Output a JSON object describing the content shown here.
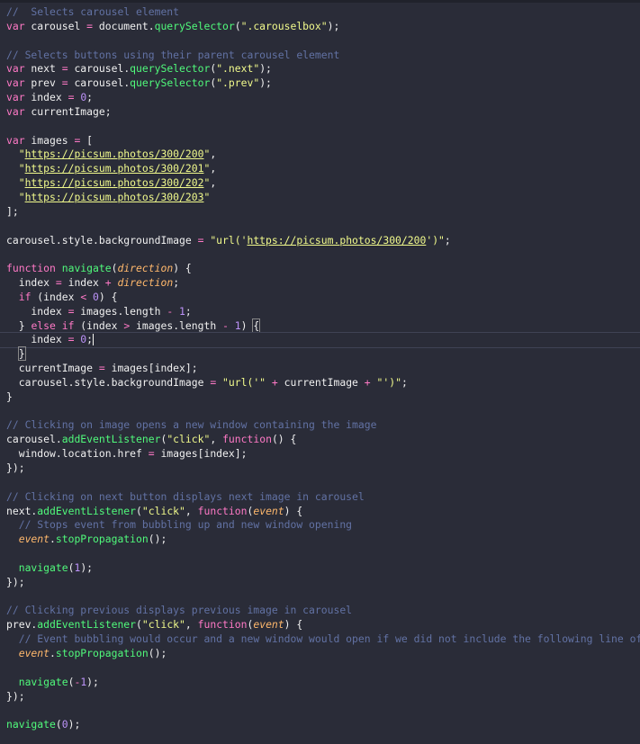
{
  "editor": {
    "language": "javascript",
    "theme_colors": {
      "background": "#2a2c38",
      "comment": "#6272a4",
      "keyword": "#ff79c6",
      "function": "#50fa7b",
      "string": "#f1fa8c",
      "number": "#bd93f9",
      "parameter": "#ffb86c"
    },
    "lines": [
      [
        {
          "t": "comment",
          "v": "//  Selects carousel element"
        }
      ],
      [
        {
          "t": "kw",
          "v": "var"
        },
        {
          "t": "var",
          "v": " carousel "
        },
        {
          "t": "op",
          "v": "="
        },
        {
          "t": "var",
          "v": " document."
        },
        {
          "t": "fn",
          "v": "querySelector"
        },
        {
          "t": "punc",
          "v": "("
        },
        {
          "t": "str",
          "v": "\".carouselbox\""
        },
        {
          "t": "punc",
          "v": ");"
        }
      ],
      [],
      [
        {
          "t": "comment",
          "v": "// Selects buttons using their parent carousel element"
        }
      ],
      [
        {
          "t": "kw",
          "v": "var"
        },
        {
          "t": "var",
          "v": " next "
        },
        {
          "t": "op",
          "v": "="
        },
        {
          "t": "var",
          "v": " carousel."
        },
        {
          "t": "fn",
          "v": "querySelector"
        },
        {
          "t": "punc",
          "v": "("
        },
        {
          "t": "str",
          "v": "\".next\""
        },
        {
          "t": "punc",
          "v": ");"
        }
      ],
      [
        {
          "t": "kw",
          "v": "var"
        },
        {
          "t": "var",
          "v": " prev "
        },
        {
          "t": "op",
          "v": "="
        },
        {
          "t": "var",
          "v": " carousel."
        },
        {
          "t": "fn",
          "v": "querySelector"
        },
        {
          "t": "punc",
          "v": "("
        },
        {
          "t": "str",
          "v": "\".prev\""
        },
        {
          "t": "punc",
          "v": ");"
        }
      ],
      [
        {
          "t": "kw",
          "v": "var"
        },
        {
          "t": "var",
          "v": " index "
        },
        {
          "t": "op",
          "v": "="
        },
        {
          "t": "var",
          "v": " "
        },
        {
          "t": "num",
          "v": "0"
        },
        {
          "t": "punc",
          "v": ";"
        }
      ],
      [
        {
          "t": "kw",
          "v": "var"
        },
        {
          "t": "var",
          "v": " currentImage;"
        }
      ],
      [],
      [
        {
          "t": "kw",
          "v": "var"
        },
        {
          "t": "var",
          "v": " images "
        },
        {
          "t": "op",
          "v": "="
        },
        {
          "t": "var",
          "v": " ["
        }
      ],
      [
        {
          "t": "var",
          "v": "  "
        },
        {
          "t": "str",
          "v": "\""
        },
        {
          "t": "link",
          "v": "https://picsum.photos/300/200"
        },
        {
          "t": "str",
          "v": "\""
        },
        {
          "t": "punc",
          "v": ","
        }
      ],
      [
        {
          "t": "var",
          "v": "  "
        },
        {
          "t": "str",
          "v": "\""
        },
        {
          "t": "link",
          "v": "https://picsum.photos/300/201"
        },
        {
          "t": "str",
          "v": "\""
        },
        {
          "t": "punc",
          "v": ","
        }
      ],
      [
        {
          "t": "var",
          "v": "  "
        },
        {
          "t": "str",
          "v": "\""
        },
        {
          "t": "link",
          "v": "https://picsum.photos/300/202"
        },
        {
          "t": "str",
          "v": "\""
        },
        {
          "t": "punc",
          "v": ","
        }
      ],
      [
        {
          "t": "var",
          "v": "  "
        },
        {
          "t": "str",
          "v": "\""
        },
        {
          "t": "link",
          "v": "https://picsum.photos/300/203"
        },
        {
          "t": "str",
          "v": "\""
        }
      ],
      [
        {
          "t": "punc",
          "v": "];"
        }
      ],
      [],
      [
        {
          "t": "var",
          "v": "carousel.style.backgroundImage "
        },
        {
          "t": "op",
          "v": "="
        },
        {
          "t": "var",
          "v": " "
        },
        {
          "t": "str",
          "v": "\"url('"
        },
        {
          "t": "link",
          "v": "https://picsum.photos/300/200"
        },
        {
          "t": "str",
          "v": "')\""
        },
        {
          "t": "punc",
          "v": ";"
        }
      ],
      [],
      [
        {
          "t": "kw",
          "v": "function"
        },
        {
          "t": "var",
          "v": " "
        },
        {
          "t": "fn",
          "v": "navigate"
        },
        {
          "t": "punc",
          "v": "("
        },
        {
          "t": "param",
          "v": "direction"
        },
        {
          "t": "punc",
          "v": ") {"
        }
      ],
      [
        {
          "t": "var",
          "v": "  index "
        },
        {
          "t": "op",
          "v": "="
        },
        {
          "t": "var",
          "v": " index "
        },
        {
          "t": "op",
          "v": "+"
        },
        {
          "t": "var",
          "v": " "
        },
        {
          "t": "param",
          "v": "direction"
        },
        {
          "t": "punc",
          "v": ";"
        }
      ],
      [
        {
          "t": "var",
          "v": "  "
        },
        {
          "t": "kw",
          "v": "if"
        },
        {
          "t": "var",
          "v": " (index "
        },
        {
          "t": "op",
          "v": "<"
        },
        {
          "t": "var",
          "v": " "
        },
        {
          "t": "num",
          "v": "0"
        },
        {
          "t": "var",
          "v": ") {"
        }
      ],
      [
        {
          "t": "var",
          "v": "    index "
        },
        {
          "t": "op",
          "v": "="
        },
        {
          "t": "var",
          "v": " images.length "
        },
        {
          "t": "op",
          "v": "-"
        },
        {
          "t": "var",
          "v": " "
        },
        {
          "t": "num",
          "v": "1"
        },
        {
          "t": "punc",
          "v": ";"
        }
      ],
      [
        {
          "t": "var",
          "v": "  } "
        },
        {
          "t": "kw",
          "v": "else if"
        },
        {
          "t": "var",
          "v": " (index "
        },
        {
          "t": "op",
          "v": ">"
        },
        {
          "t": "var",
          "v": " images.length "
        },
        {
          "t": "op",
          "v": "-"
        },
        {
          "t": "var",
          "v": " "
        },
        {
          "t": "num",
          "v": "1"
        },
        {
          "t": "var",
          "v": ") "
        },
        {
          "t": "bracket",
          "v": "{"
        }
      ],
      [
        {
          "t": "var",
          "v": "    index "
        },
        {
          "t": "op",
          "v": "="
        },
        {
          "t": "var",
          "v": " "
        },
        {
          "t": "num",
          "v": "0"
        },
        {
          "t": "punc",
          "v": ";"
        },
        {
          "t": "cursor",
          "v": ""
        }
      ],
      [
        {
          "t": "var",
          "v": "  "
        },
        {
          "t": "bracket",
          "v": "}"
        }
      ],
      [
        {
          "t": "var",
          "v": "  currentImage "
        },
        {
          "t": "op",
          "v": "="
        },
        {
          "t": "var",
          "v": " images[index];"
        }
      ],
      [
        {
          "t": "var",
          "v": "  carousel.style.backgroundImage "
        },
        {
          "t": "op",
          "v": "="
        },
        {
          "t": "var",
          "v": " "
        },
        {
          "t": "str",
          "v": "\"url('\""
        },
        {
          "t": "var",
          "v": " "
        },
        {
          "t": "op",
          "v": "+"
        },
        {
          "t": "var",
          "v": " currentImage "
        },
        {
          "t": "op",
          "v": "+"
        },
        {
          "t": "var",
          "v": " "
        },
        {
          "t": "str",
          "v": "\"')\""
        },
        {
          "t": "punc",
          "v": ";"
        }
      ],
      [
        {
          "t": "punc",
          "v": "}"
        }
      ],
      [],
      [
        {
          "t": "comment",
          "v": "// Clicking on image opens a new window containing the image"
        }
      ],
      [
        {
          "t": "var",
          "v": "carousel."
        },
        {
          "t": "fn",
          "v": "addEventListener"
        },
        {
          "t": "punc",
          "v": "("
        },
        {
          "t": "str",
          "v": "\"click\""
        },
        {
          "t": "punc",
          "v": ", "
        },
        {
          "t": "kw",
          "v": "function"
        },
        {
          "t": "punc",
          "v": "() {"
        }
      ],
      [
        {
          "t": "var",
          "v": "  window.location.href "
        },
        {
          "t": "op",
          "v": "="
        },
        {
          "t": "var",
          "v": " images[index];"
        }
      ],
      [
        {
          "t": "punc",
          "v": "});"
        }
      ],
      [],
      [
        {
          "t": "comment",
          "v": "// Clicking on next button displays next image in carousel"
        }
      ],
      [
        {
          "t": "var",
          "v": "next."
        },
        {
          "t": "fn",
          "v": "addEventListener"
        },
        {
          "t": "punc",
          "v": "("
        },
        {
          "t": "str",
          "v": "\"click\""
        },
        {
          "t": "punc",
          "v": ", "
        },
        {
          "t": "kw",
          "v": "function"
        },
        {
          "t": "punc",
          "v": "("
        },
        {
          "t": "param",
          "v": "event"
        },
        {
          "t": "punc",
          "v": ") {"
        }
      ],
      [
        {
          "t": "var",
          "v": "  "
        },
        {
          "t": "comment",
          "v": "// Stops event from bubbling up and new window opening"
        }
      ],
      [
        {
          "t": "var",
          "v": "  "
        },
        {
          "t": "param",
          "v": "event"
        },
        {
          "t": "var",
          "v": "."
        },
        {
          "t": "fn",
          "v": "stopPropagation"
        },
        {
          "t": "punc",
          "v": "();"
        }
      ],
      [],
      [
        {
          "t": "var",
          "v": "  "
        },
        {
          "t": "fn",
          "v": "navigate"
        },
        {
          "t": "punc",
          "v": "("
        },
        {
          "t": "num",
          "v": "1"
        },
        {
          "t": "punc",
          "v": ");"
        }
      ],
      [
        {
          "t": "punc",
          "v": "});"
        }
      ],
      [],
      [
        {
          "t": "comment",
          "v": "// Clicking previous displays previous image in carousel"
        }
      ],
      [
        {
          "t": "var",
          "v": "prev."
        },
        {
          "t": "fn",
          "v": "addEventListener"
        },
        {
          "t": "punc",
          "v": "("
        },
        {
          "t": "str",
          "v": "\"click\""
        },
        {
          "t": "punc",
          "v": ", "
        },
        {
          "t": "kw",
          "v": "function"
        },
        {
          "t": "punc",
          "v": "("
        },
        {
          "t": "param",
          "v": "event"
        },
        {
          "t": "punc",
          "v": ") {"
        }
      ],
      [
        {
          "t": "var",
          "v": "  "
        },
        {
          "t": "comment",
          "v": "// Event bubbling would occur and a new window would open if we did not include the following line of code."
        }
      ],
      [
        {
          "t": "var",
          "v": "  "
        },
        {
          "t": "param",
          "v": "event"
        },
        {
          "t": "var",
          "v": "."
        },
        {
          "t": "fn",
          "v": "stopPropagation"
        },
        {
          "t": "punc",
          "v": "();"
        }
      ],
      [],
      [
        {
          "t": "var",
          "v": "  "
        },
        {
          "t": "fn",
          "v": "navigate"
        },
        {
          "t": "punc",
          "v": "("
        },
        {
          "t": "op",
          "v": "-"
        },
        {
          "t": "num",
          "v": "1"
        },
        {
          "t": "punc",
          "v": ");"
        }
      ],
      [
        {
          "t": "punc",
          "v": "});"
        }
      ],
      [],
      [
        {
          "t": "fn",
          "v": "navigate"
        },
        {
          "t": "punc",
          "v": "("
        },
        {
          "t": "num",
          "v": "0"
        },
        {
          "t": "punc",
          "v": ");"
        }
      ]
    ]
  }
}
